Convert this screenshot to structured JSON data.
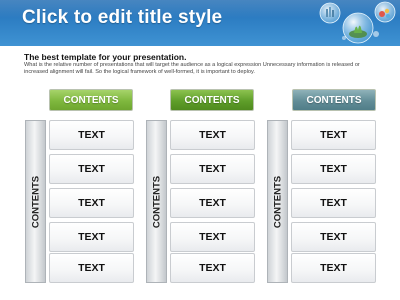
{
  "header": {
    "title": "Click to edit title style"
  },
  "intro": {
    "heading": "The best template for your presentation.",
    "body": "What is the relative number of presentations that will target the audience as a logical expression Unnecessary information is released or increased alignment will fail. So the logical framework of well-formed, it is important to deploy."
  },
  "columns": [
    {
      "header": "CONTENTS",
      "side_label": "CONTENTS",
      "cells": [
        "TEXT",
        "TEXT",
        "TEXT",
        "TEXT",
        "TEXT"
      ]
    },
    {
      "header": "CONTENTS",
      "side_label": "CONTENTS",
      "cells": [
        "TEXT",
        "TEXT",
        "TEXT",
        "TEXT",
        "TEXT"
      ]
    },
    {
      "header": "CONTENTS",
      "side_label": "CONTENTS",
      "cells": [
        "TEXT",
        "TEXT",
        "TEXT",
        "TEXT",
        "TEXT"
      ]
    }
  ],
  "icons": {
    "decoration": "globe-bubbles-icon"
  }
}
